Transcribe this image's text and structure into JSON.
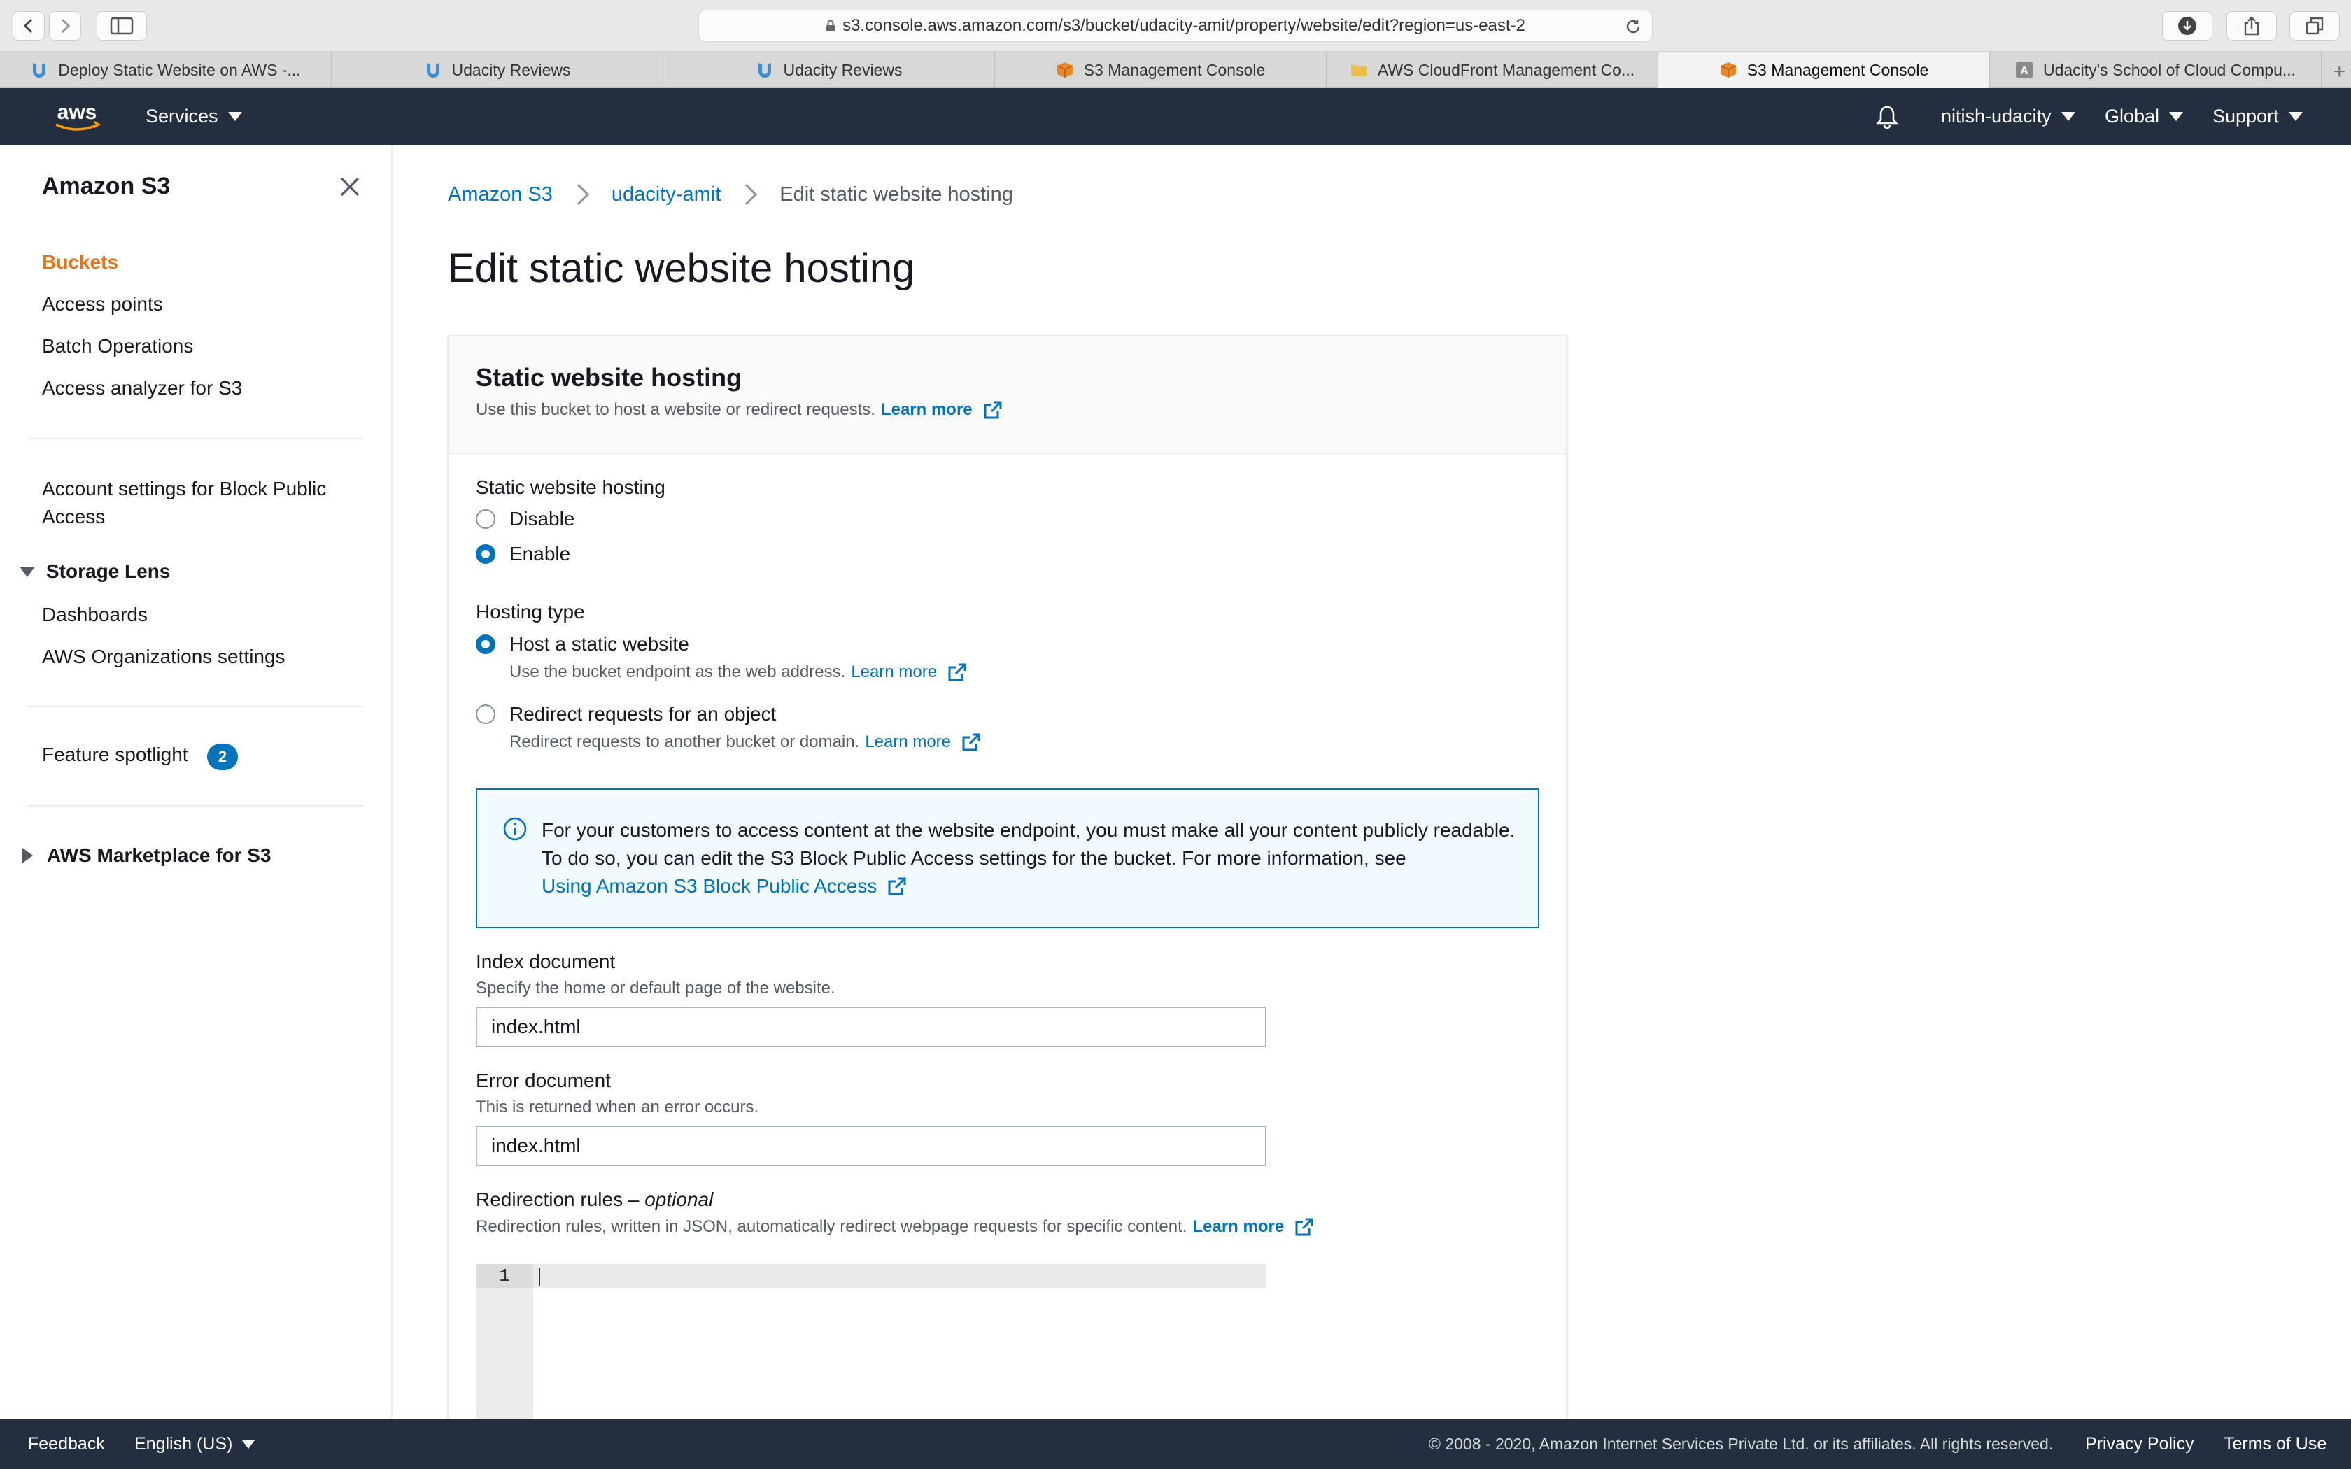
{
  "browser": {
    "url": "s3.console.aws.amazon.com/s3/bucket/udacity-amit/property/website/edit?region=us-east-2",
    "tabs": [
      {
        "label": "Deploy Static Website on AWS -...",
        "favicon": "udacity-icon",
        "active": false
      },
      {
        "label": "Udacity Reviews",
        "favicon": "udacity-icon",
        "active": false
      },
      {
        "label": "Udacity Reviews",
        "favicon": "udacity-icon",
        "active": false
      },
      {
        "label": "S3 Management Console",
        "favicon": "aws-cube-icon",
        "active": false
      },
      {
        "label": "AWS CloudFront Management Co...",
        "favicon": "folder-icon",
        "active": false
      },
      {
        "label": "S3 Management Console",
        "favicon": "aws-cube-icon",
        "active": true
      },
      {
        "label": "Udacity's School of Cloud Compu...",
        "favicon": "letter-a-icon",
        "active": false
      }
    ]
  },
  "header": {
    "logo_text": "aws",
    "services_label": "Services",
    "account_label": "nitish-udacity",
    "region_label": "Global",
    "support_label": "Support"
  },
  "sidebar": {
    "title": "Amazon S3",
    "items": [
      {
        "label": "Buckets",
        "active": true
      },
      {
        "label": "Access points"
      },
      {
        "label": "Batch Operations"
      },
      {
        "label": "Access analyzer for S3"
      }
    ],
    "block_public_access": "Account settings for Block Public Access",
    "storage_lens": {
      "label": "Storage Lens",
      "items": [
        {
          "label": "Dashboards"
        },
        {
          "label": "AWS Organizations settings"
        }
      ]
    },
    "feature_spotlight": {
      "label": "Feature spotlight",
      "count": "2"
    },
    "marketplace": "AWS Marketplace for S3"
  },
  "breadcrumb": [
    {
      "label": "Amazon S3"
    },
    {
      "label": "udacity-amit"
    },
    {
      "label": "Edit static website hosting"
    }
  ],
  "page": {
    "title": "Edit static website hosting"
  },
  "panel": {
    "title": "Static website hosting",
    "description": "Use this bucket to host a website or redirect requests.",
    "learn_more": "Learn more"
  },
  "hosting": {
    "label": "Static website hosting",
    "options": [
      {
        "label": "Disable",
        "checked": false
      },
      {
        "label": "Enable",
        "checked": true
      }
    ]
  },
  "hosting_type": {
    "label": "Hosting type",
    "options": [
      {
        "label": "Host a static website",
        "description": "Use the bucket endpoint as the web address.",
        "learn_more": "Learn more",
        "checked": true
      },
      {
        "label": "Redirect requests for an object",
        "description": "Redirect requests to another bucket or domain.",
        "learn_more": "Learn more",
        "checked": false
      }
    ]
  },
  "info_alert": {
    "text": "For your customers to access content at the website endpoint, you must make all your content publicly readable. To do so, you can edit the S3 Block Public Access settings for the bucket. For more information, see",
    "link": "Using Amazon S3 Block Public Access"
  },
  "index_document": {
    "label": "Index document",
    "description": "Specify the home or default page of the website.",
    "value": "index.html"
  },
  "error_document": {
    "label": "Error document",
    "description": "This is returned when an error occurs.",
    "value": "index.html"
  },
  "redirection_rules": {
    "label": "Redirection rules – ",
    "optional": "optional",
    "description": "Redirection rules, written in JSON, automatically redirect webpage requests for specific content.",
    "learn_more": "Learn more",
    "line_number": "1"
  },
  "footer": {
    "feedback": "Feedback",
    "language": "English (US)",
    "copyright": "© 2008 - 2020, Amazon Internet Services Private Ltd. or its affiliates. All rights reserved.",
    "privacy": "Privacy Policy",
    "terms": "Terms of Use"
  },
  "colors": {
    "aws_header": "#232f3e",
    "link_blue": "#0073bb",
    "active_orange": "#ec7211",
    "info_bg": "#f1faff"
  }
}
